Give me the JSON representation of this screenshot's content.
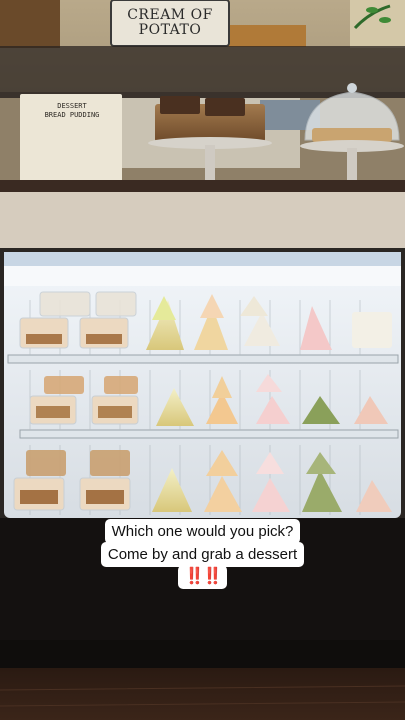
{
  "sign": {
    "line1": "CREAM OF",
    "line2": "POTATO"
  },
  "menu_board": {
    "lines": [
      "DESSERT",
      "BREAD PUDDING"
    ]
  },
  "caption": {
    "line1": "Which one would you pick?",
    "line2": "Come by and grab a dessert",
    "emoji": "‼️‼️"
  },
  "colors": {
    "caption_bg": "#ffffff",
    "caption_text": "#111111",
    "emoji_red": "#e3231b",
    "case_light": "#e8eef4",
    "wood": "#3a2418"
  }
}
